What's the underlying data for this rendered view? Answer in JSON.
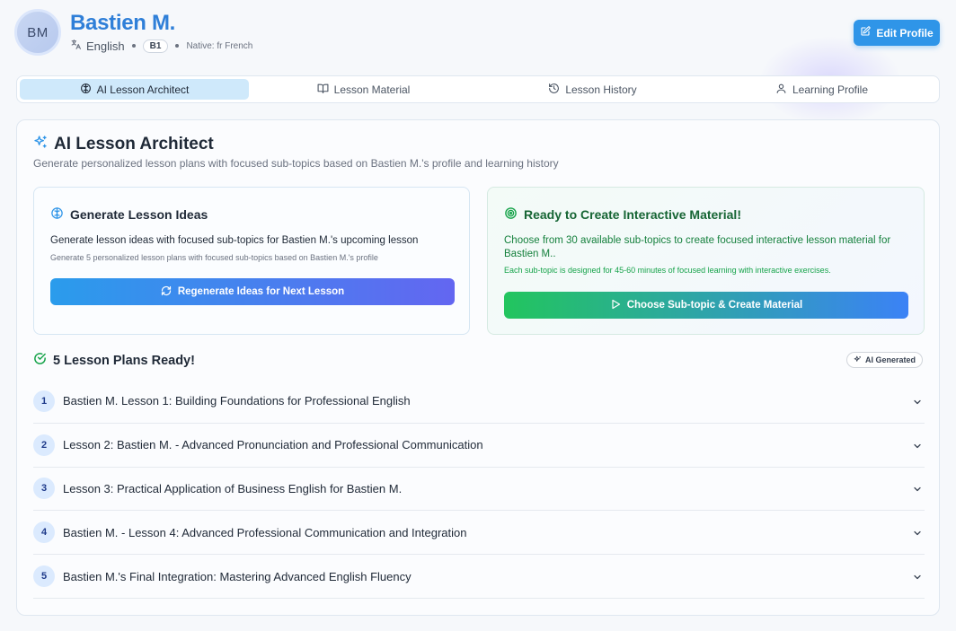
{
  "profile": {
    "initials": "BM",
    "name": "Bastien M.",
    "language": "English",
    "level": "B1",
    "native": "Native: fr French"
  },
  "header": {
    "edit_label": "Edit Profile"
  },
  "tabs": [
    {
      "label": "AI Lesson Architect",
      "icon": "brain-icon",
      "active": true
    },
    {
      "label": "Lesson Material",
      "icon": "book-open-icon",
      "active": false
    },
    {
      "label": "Lesson History",
      "icon": "history-icon",
      "active": false
    },
    {
      "label": "Learning Profile",
      "icon": "user-icon",
      "active": false
    }
  ],
  "main": {
    "title": "AI Lesson Architect",
    "subtitle": "Generate personalized lesson plans with focused sub-topics based on Bastien M.'s profile and learning history"
  },
  "generate": {
    "title": "Generate Lesson Ideas",
    "text": "Generate lesson ideas with focused sub-topics for Bastien M.'s upcoming lesson",
    "small": "Generate 5 personalized lesson plans with focused sub-topics based on Bastien M.'s profile",
    "button": "Regenerate Ideas for Next Lesson"
  },
  "ready": {
    "title": "Ready to Create Interactive Material!",
    "text": "Choose from 30 available sub-topics to create focused interactive lesson material for Bastien M..",
    "small": "Each sub-topic is designed for 45-60 minutes of focused learning with interactive exercises.",
    "button": "Choose Sub-topic & Create Material"
  },
  "plans": {
    "heading": "5 Lesson Plans Ready!",
    "badge": "AI Generated",
    "items": [
      {
        "num": "1",
        "title": "Bastien M. Lesson 1: Building Foundations for Professional English"
      },
      {
        "num": "2",
        "title": "Lesson 2: Bastien M. - Advanced Pronunciation and Professional Communication"
      },
      {
        "num": "3",
        "title": "Lesson 3: Practical Application of Business English for Bastien M."
      },
      {
        "num": "4",
        "title": "Bastien M. - Lesson 4: Advanced Professional Communication and Integration"
      },
      {
        "num": "5",
        "title": "Bastien M.'s Final Integration: Mastering Advanced English Fluency"
      }
    ]
  },
  "colors": {
    "brand": "#2f7fd8",
    "primary_button": "#2f95e8",
    "active_tab": "#cfe9fb",
    "success": "#166534"
  }
}
